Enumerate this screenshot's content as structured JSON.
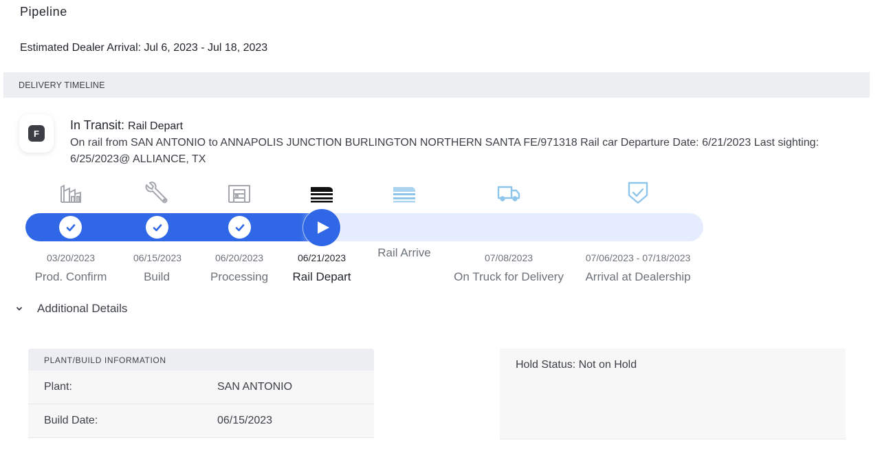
{
  "page": {
    "title": "Pipeline",
    "eta_label": "Estimated Dealer Arrival: Jul 6, 2023 - Jul 18, 2023"
  },
  "timeline": {
    "header": "DELIVERY TIMELINE",
    "status_badge": "F",
    "status_title": "In Transit:",
    "status_subtitle": "Rail Depart",
    "status_description": "On rail from SAN ANTONIO to ANNAPOLIS JUNCTION BURLINGTON NORTHERN SANTA FE/971318 Rail car Departure Date: 6/21/2023 Last sighting: 6/25/2023@ ALLIANCE, TX",
    "progress_fraction": 0.46,
    "stages": [
      {
        "icon": "factory-icon",
        "date": "03/20/2023",
        "label": "Prod. Confirm",
        "state": "complete"
      },
      {
        "icon": "wrench-icon",
        "date": "06/15/2023",
        "label": "Build",
        "state": "complete"
      },
      {
        "icon": "warehouse-icon",
        "date": "06/20/2023",
        "label": "Processing",
        "state": "complete"
      },
      {
        "icon": "rail-depart-icon",
        "date": "06/21/2023",
        "label": "Rail Depart",
        "state": "current"
      },
      {
        "icon": "rail-arrive-icon",
        "date": "",
        "label": "Rail Arrive",
        "state": "upcoming"
      },
      {
        "icon": "truck-icon",
        "date": "07/08/2023",
        "label": "On Truck for Delivery",
        "state": "upcoming"
      },
      {
        "icon": "shield-check-icon",
        "date": "07/06/2023 - 07/18/2023",
        "label": "Arrival at Dealership",
        "state": "upcoming"
      }
    ]
  },
  "details": {
    "toggle_label": "Additional Details",
    "plant_card": {
      "header": "PLANT/BUILD INFORMATION",
      "rows": [
        {
          "key": "Plant:",
          "value": "SAN ANTONIO"
        },
        {
          "key": "Build Date:",
          "value": "06/15/2023"
        }
      ]
    },
    "hold_status": "Hold Status: Not on Hold"
  },
  "colors": {
    "accent": "#2f67e6",
    "track": "#e5ecfd",
    "muted_icon": "#9ca0a6",
    "upcoming_icon": "#8ec5ea"
  }
}
